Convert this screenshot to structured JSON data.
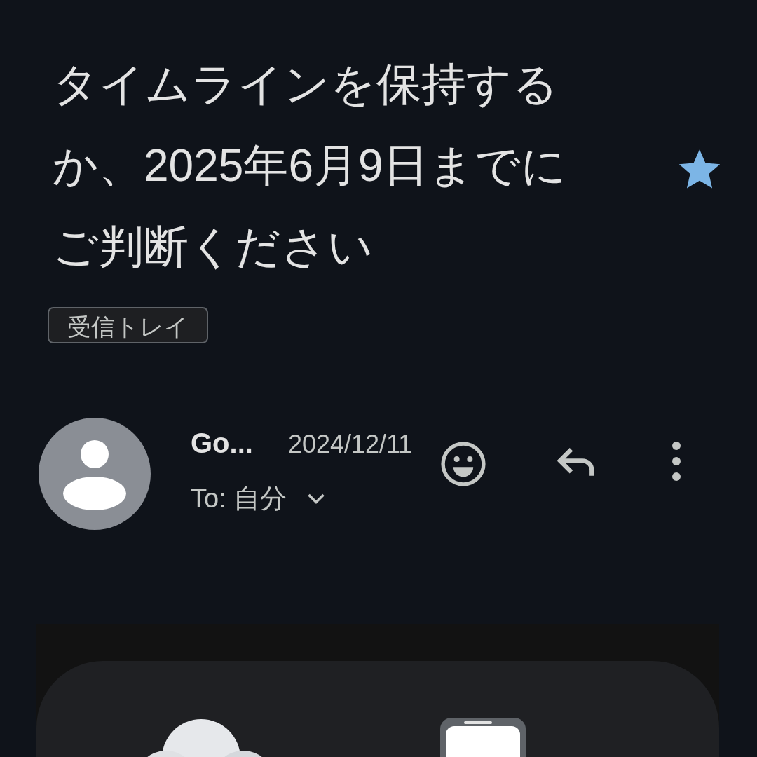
{
  "subject": "タイムラインを保持するか、2025年6月9日までにご判断ください",
  "starred": true,
  "label": "受信トレイ",
  "message": {
    "sender": "Go...",
    "date": "2024/12/11",
    "recipient": "To: 自分"
  }
}
